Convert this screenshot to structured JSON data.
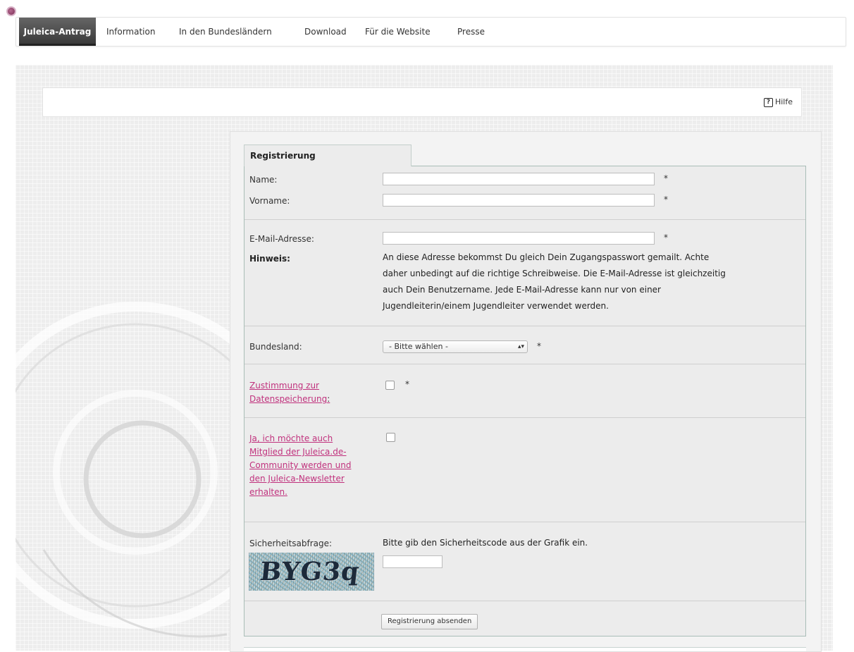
{
  "nav": {
    "active": "Juleica-Antrag",
    "items": [
      "Information",
      "In den Bundesländern",
      "Download",
      "Für die Website",
      "Presse"
    ]
  },
  "help": {
    "label": "Hilfe",
    "icon": "help-icon"
  },
  "form": {
    "tab_title": "Registrierung",
    "name_label": "Name:",
    "vorname_label": "Vorname:",
    "email_label": "E-Mail-Adresse:",
    "hint_label": "Hinweis:",
    "hint_lines": [
      "An diese Adresse bekommst Du gleich Dein Zugangspasswort gemailt. Achte",
      "daher unbedingt auf die richtige Schreibweise. Die E-Mail-Adresse ist gleichzeitig",
      "auch Dein Benutzername. Jede E-Mail-Adresse kann nur von einer",
      "Jugendleiterin/einem Jugendleiter verwendet werden."
    ],
    "bundesland_label": "Bundesland:",
    "bundesland_selected": "- Bitte wählen -",
    "zustimmung_line1": "Zustimmung zur",
    "zustimmung_line2": "Datenspeicherung",
    "zustimmung_colon": ":",
    "newsletter_lines": [
      "Ja, ich möchte auch",
      "Mitglied der Juleica.de-",
      "Community werden und",
      "den Juleica-Newsletter",
      "erhalten."
    ],
    "security_label": "Sicherheitsabfrage:",
    "security_hint": "Bitte gib den Sicherheitscode aus der Grafik ein.",
    "captcha_code": "BYG3q",
    "submit_label": "Registrierung absenden",
    "required_marker": "*"
  },
  "colors": {
    "link": "#c0317d",
    "nav_active_bg": "#4a4a4a",
    "panel_border": "#a9bdb7"
  }
}
